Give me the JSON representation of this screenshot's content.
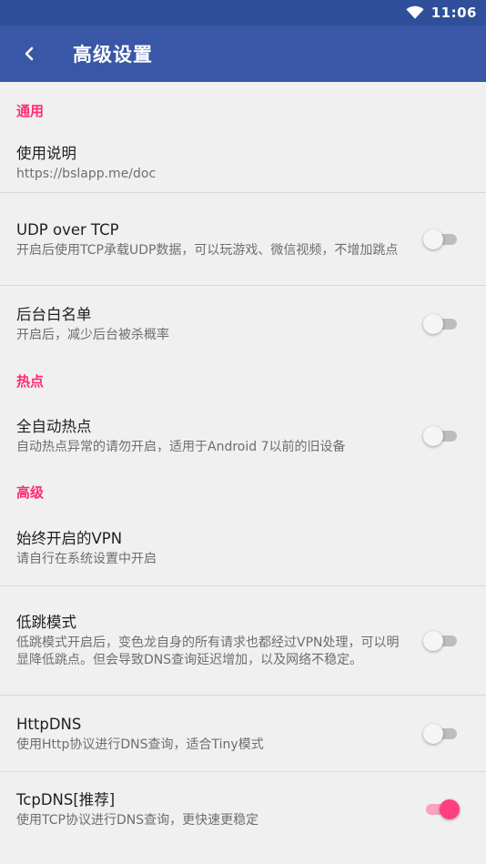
{
  "status_bar": {
    "time": "11:06",
    "wifi_icon": "wifi-icon"
  },
  "app_bar": {
    "title": "高级设置",
    "back_icon": "back-arrow-icon"
  },
  "colors": {
    "primary": "#3957a6",
    "accent": "#ff2d6f",
    "status_bar": "#2f4f9a"
  },
  "sections": {
    "general": {
      "header": "通用",
      "usage": {
        "title": "使用说明",
        "summary": "https://bslapp.me/doc"
      },
      "udp": {
        "title": "UDP over TCP",
        "summary": "开启后使用TCP承载UDP数据，可以玩游戏、微信视频，不增加跳点",
        "enabled": false
      },
      "whitelist": {
        "title": "后台白名单",
        "summary": "开启后，减少后台被杀概率",
        "enabled": false
      }
    },
    "hotspot": {
      "header": "热点",
      "auto_hotspot": {
        "title": "全自动热点",
        "summary": "自动热点异常的请勿开启，适用于Android 7以前的旧设备",
        "enabled": false
      }
    },
    "advanced": {
      "header": "高级",
      "always_on_vpn": {
        "title": "始终开启的VPN",
        "summary": "请自行在系统设置中开启"
      },
      "low_hop": {
        "title": "低跳模式",
        "summary": "低跳模式开启后，变色龙自身的所有请求也都经过VPN处理，可以明显降低跳点。但会导致DNS查询延迟增加，以及网络不稳定。",
        "enabled": false
      },
      "httpdns": {
        "title": "HttpDNS",
        "summary": "使用Http协议进行DNS查询，适合Tiny模式",
        "enabled": false
      },
      "tcpdns": {
        "title": "TcpDNS[推荐]",
        "summary": "使用TCP协议进行DNS查询，更快速更稳定",
        "enabled": true
      }
    }
  }
}
